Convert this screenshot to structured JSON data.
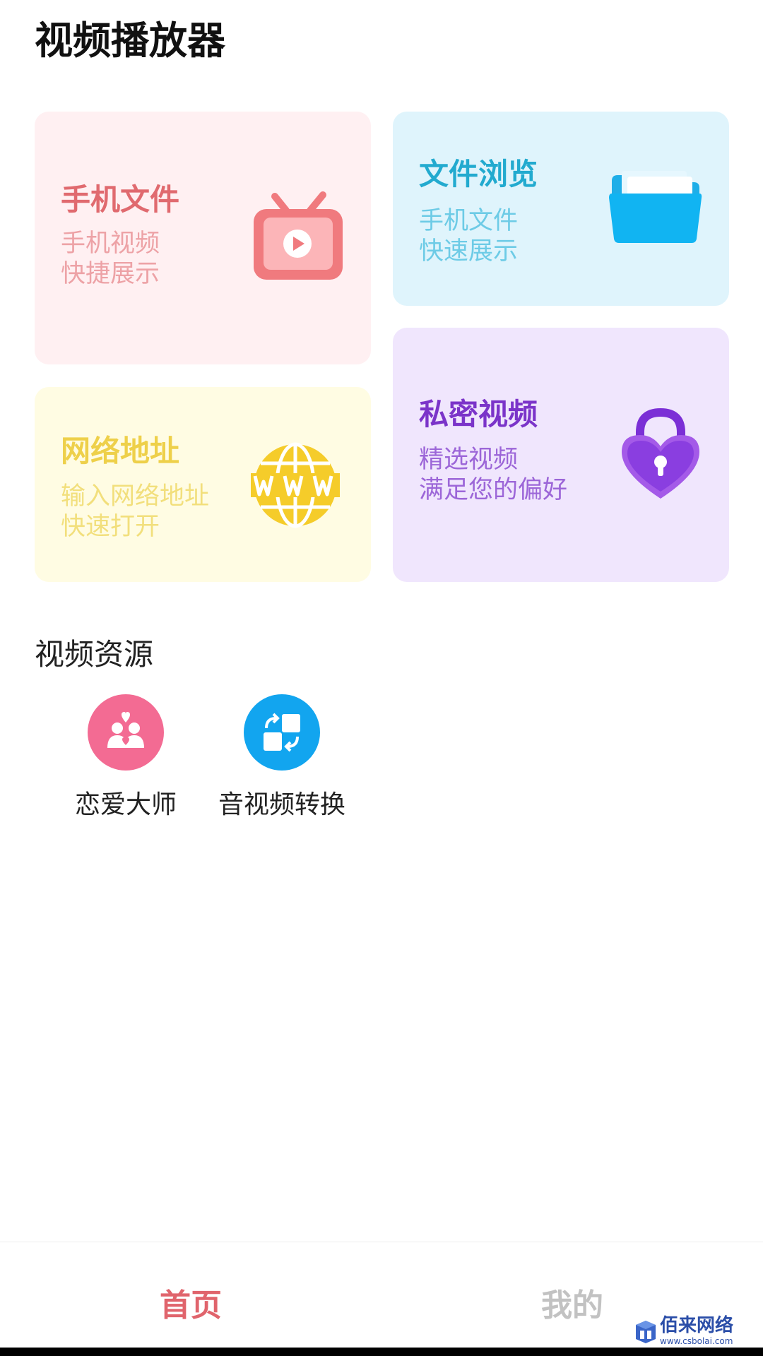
{
  "app": {
    "title": "视频播放器"
  },
  "cards": {
    "phone_files": {
      "title": "手机文件",
      "line1": "手机视频",
      "line2": "快捷展示",
      "icon": "tv-play-icon",
      "color": "#e06a6f"
    },
    "file_browse": {
      "title": "文件浏览",
      "line1": "手机文件",
      "line2": "快速展示",
      "icon": "folder-icon",
      "color": "#22aacf"
    },
    "web_address": {
      "title": "网络地址",
      "line1": "输入网络地址",
      "line2": "快速打开",
      "icon": "globe-www-icon",
      "color": "#eed04a"
    },
    "private_video": {
      "title": "私密视频",
      "line1": "精选视频",
      "line2": "满足您的偏好",
      "icon": "heart-lock-icon",
      "color": "#7b34c9"
    }
  },
  "resources": {
    "title": "视频资源",
    "items": [
      {
        "label": "恋爱大师",
        "icon": "couple-heart-icon",
        "color": "#f36b93"
      },
      {
        "label": "音视频转换",
        "icon": "convert-icon",
        "color": "#12a5ef"
      }
    ]
  },
  "nav": {
    "home": {
      "label": "首页",
      "active": true,
      "color": "#e0646c"
    },
    "mine": {
      "label": "我的",
      "active": false,
      "color": "#c2c2c2"
    }
  },
  "watermark": {
    "text": "佰来网络",
    "url": "www.csbolai.com"
  }
}
